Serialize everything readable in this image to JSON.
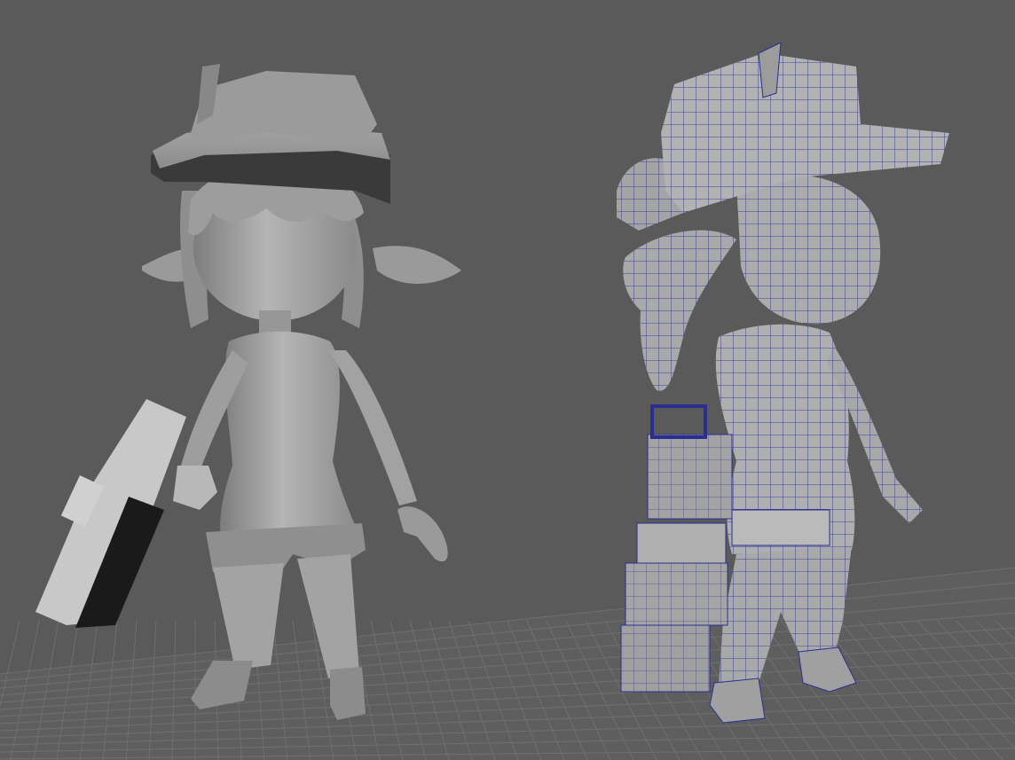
{
  "viewport": {
    "background_color": "#5a5a5a",
    "grid_color": "#6f6f6f",
    "shaded_model_color": "#a7a7a7",
    "wireframe_color": "#2a2f8f"
  },
  "models": [
    {
      "name": "shaded-character",
      "display_mode": "smooth-shaded"
    },
    {
      "name": "wireframe-character",
      "display_mode": "shaded-with-wireframe"
    }
  ]
}
